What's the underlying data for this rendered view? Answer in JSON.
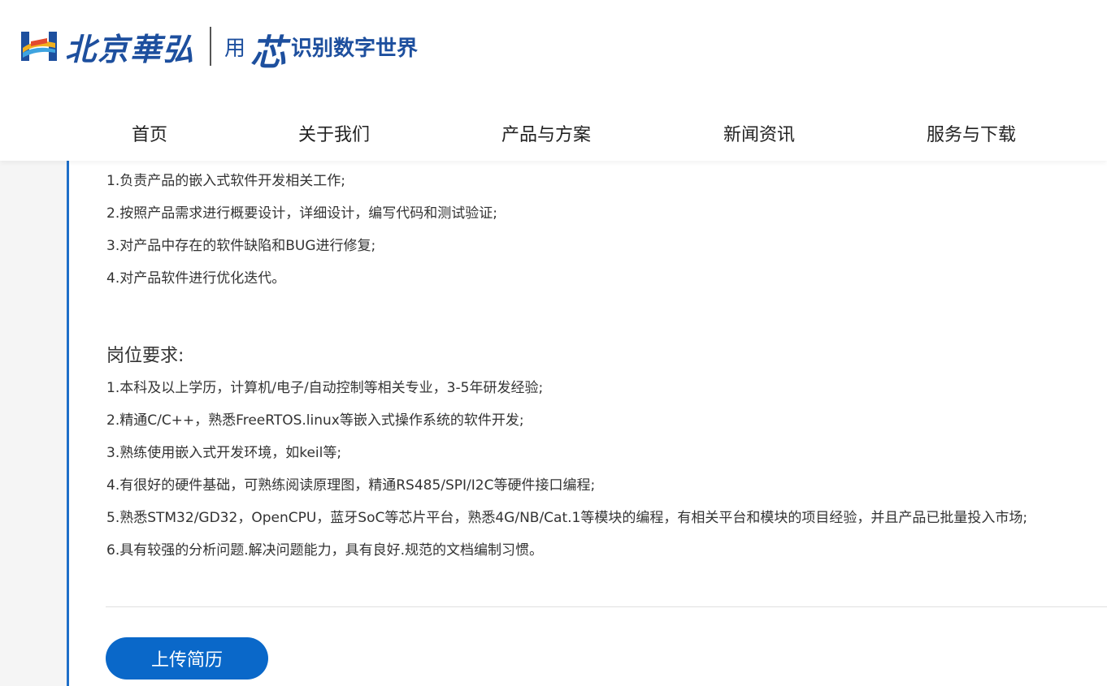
{
  "brand": {
    "name": "北京華弘",
    "slogan_prefix": "用",
    "slogan_core": "芯",
    "slogan_suffix": "识别数字世界",
    "colors": {
      "brand_blue": "#1d4f9e",
      "accent_blue": "#0a68c9",
      "rule_blue": "#1f6fc9"
    },
    "logo_icon": "hh-logo-mark"
  },
  "nav": {
    "items": [
      {
        "label": "首页"
      },
      {
        "label": "关于我们"
      },
      {
        "label": "产品与方案"
      },
      {
        "label": "新闻资讯"
      },
      {
        "label": "服务与下载"
      }
    ]
  },
  "job": {
    "duties": [
      "1.负责产品的嵌入式软件开发相关工作;",
      "2.按照产品需求进行概要设计，详细设计，编写代码和测试验证;",
      "3.对产品中存在的软件缺陷和BUG进行修复;",
      "4.对产品软件进行优化迭代。"
    ],
    "requirements_title": "岗位要求:",
    "requirements": [
      "1.本科及以上学历，计算机/电子/自动控制等相关专业，3-5年研发经验;",
      "2.精通C/C++，熟悉FreeRTOS.linux等嵌入式操作系统的软件开发;",
      "3.熟练使用嵌入式开发环境，如keil等;",
      "4.有很好的硬件基础，可熟练阅读原理图，精通RS485/SPI/I2C等硬件接口编程;",
      "5.熟悉STM32/GD32，OpenCPU，蓝牙SoC等芯片平台，熟悉4G/NB/Cat.1等模块的编程，有相关平台和模块的项目经验，并且产品已批量投入市场;",
      "6.具有较强的分析问题.解决问题能力，具有良好.规范的文档编制习惯。"
    ],
    "upload_label": "上传简历"
  }
}
